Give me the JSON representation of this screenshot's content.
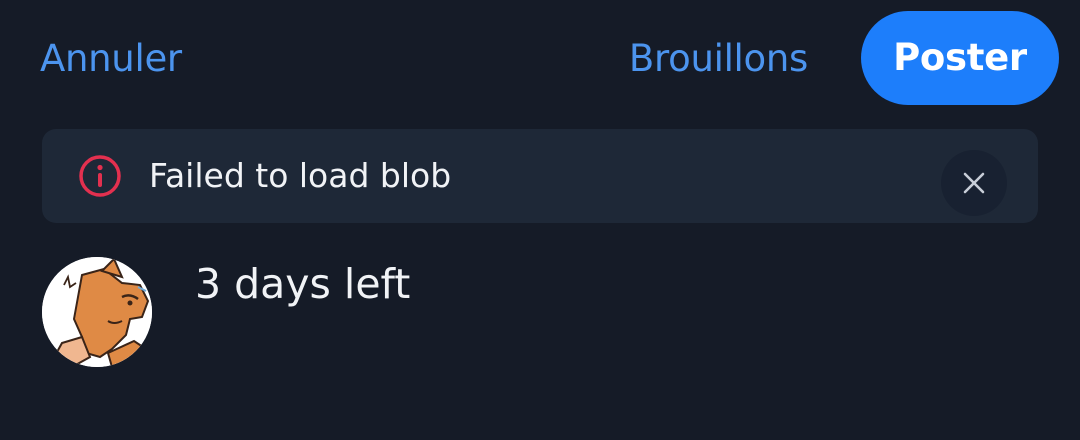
{
  "header": {
    "cancel_label": "Annuler",
    "drafts_label": "Brouillons",
    "post_label": "Poster"
  },
  "error_banner": {
    "message": "Failed to load blob",
    "icon": "info-circle-icon",
    "dismiss_icon": "close-icon"
  },
  "composer": {
    "text": "3 days left",
    "avatar": "avatar-image"
  },
  "colors": {
    "background": "#151b27",
    "accent": "#1d7efb",
    "link": "#4c94ee",
    "error": "#e3304f",
    "banner": "#1e2837"
  }
}
